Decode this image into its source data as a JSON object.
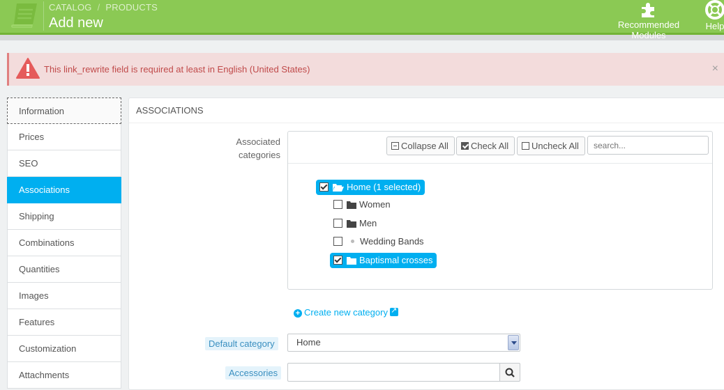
{
  "header": {
    "breadcrumb": [
      "CATALOG",
      "PRODUCTS"
    ],
    "breadcrumb_sep": "/",
    "title": "Add new",
    "buttons": [
      {
        "label": "Recommended Modules",
        "icon": "puzzle-icon"
      },
      {
        "label": "Help",
        "icon": "lifebuoy-icon"
      }
    ],
    "logo_icon": "book-icon",
    "colors": {
      "bar": "#8bc954",
      "accent": "#00aff0"
    }
  },
  "alert": {
    "message": "This link_rewrite field is required at least in English (United States)",
    "close": "×",
    "icon": "warning-icon"
  },
  "sidebar": {
    "tabs": [
      "Information",
      "Prices",
      "SEO",
      "Associations",
      "Shipping",
      "Combinations",
      "Quantities",
      "Images",
      "Features",
      "Customization",
      "Attachments"
    ],
    "active": "Associations"
  },
  "panel": {
    "heading": "ASSOCIATIONS",
    "associated_label_line1": "Associated",
    "associated_label_line2": "categories",
    "toolbar": {
      "collapse": "Collapse All",
      "check": "Check All",
      "uncheck": "Uncheck All",
      "search_placeholder": "search..."
    },
    "tree": {
      "root": "Home (1 selected)",
      "children": [
        {
          "label": "Women",
          "checked": false,
          "icon": "folder-icon"
        },
        {
          "label": "Men",
          "checked": false,
          "icon": "folder-icon"
        },
        {
          "label": "Wedding Bands",
          "checked": false,
          "icon": "bullet-icon"
        },
        {
          "label": "Baptismal crosses",
          "checked": true,
          "icon": "folder-icon"
        }
      ]
    },
    "create_link": "Create new category",
    "default_category_label": "Default category",
    "default_category_value": "Home",
    "accessories_label": "Accessories",
    "accessories_value": ""
  }
}
